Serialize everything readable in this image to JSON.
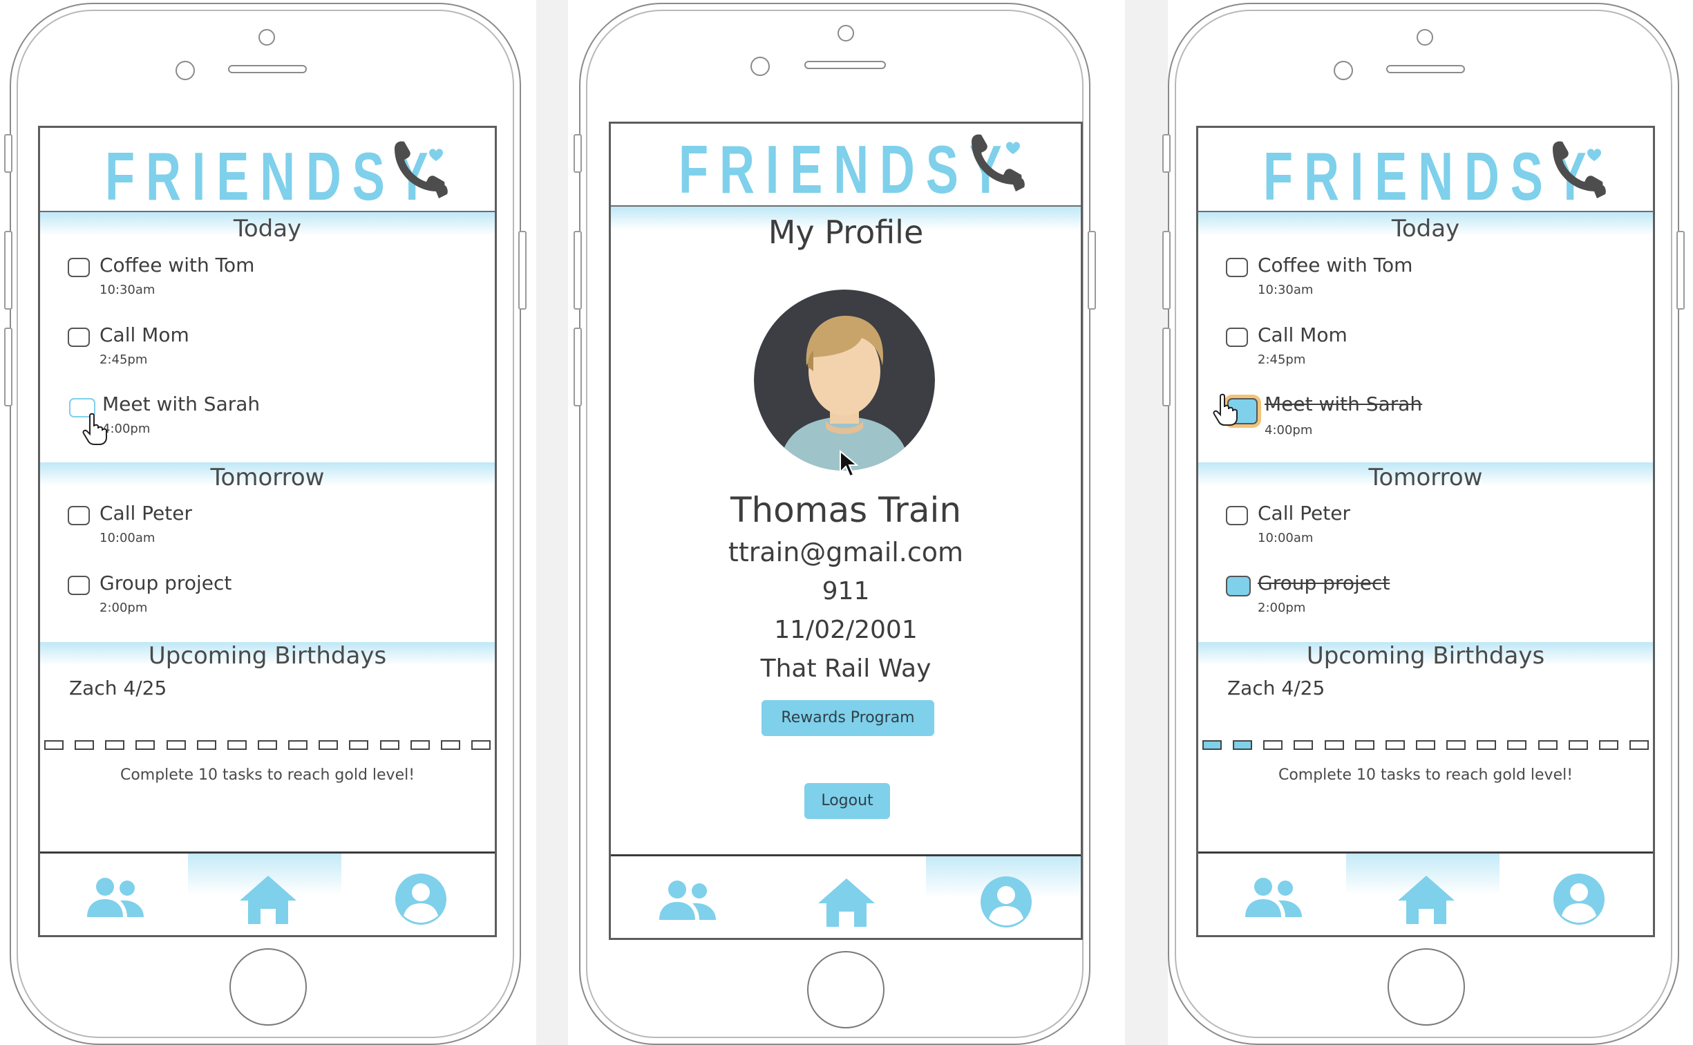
{
  "brand": {
    "name": "FRIENDSY",
    "accent": "#7fd0eb",
    "icon": "phone-heart-icon"
  },
  "screens": [
    {
      "id": "home-before",
      "sections": {
        "today": "Today",
        "tomorrow": "Tomorrow",
        "birthdays": "Upcoming Birthdays"
      },
      "today_tasks": [
        {
          "label": "Coffee with Tom",
          "time": "10:30am",
          "checked": false
        },
        {
          "label": "Call Mom",
          "time": "2:45pm",
          "checked": false
        },
        {
          "label": "Meet with Sarah",
          "time": "4:00pm",
          "checked": false
        }
      ],
      "tomorrow_tasks": [
        {
          "label": "Call Peter",
          "time": "10:00am",
          "checked": false
        },
        {
          "label": "Group project",
          "time": "2:00pm",
          "checked": false
        }
      ],
      "birthdays": [
        {
          "text": "Zach 4/25"
        }
      ],
      "progress": {
        "total": 15,
        "filled": 0
      },
      "gold_message": "Complete 10 tasks to reach gold level!",
      "active_tab": "home"
    },
    {
      "id": "profile",
      "title": "My Profile",
      "name": "Thomas Train",
      "email": "ttrain@gmail.com",
      "phone": "911",
      "dob": "11/02/2001",
      "address": "That Rail Way",
      "rewards_button": "Rewards Program",
      "logout_button": "Logout",
      "active_tab": "profile"
    },
    {
      "id": "home-after",
      "sections": {
        "today": "Today",
        "tomorrow": "Tomorrow",
        "birthdays": "Upcoming Birthdays"
      },
      "today_tasks": [
        {
          "label": "Coffee with Tom",
          "time": "10:30am",
          "checked": false
        },
        {
          "label": "Call Mom",
          "time": "2:45pm",
          "checked": false
        },
        {
          "label": "Meet with Sarah",
          "time": "4:00pm",
          "checked": true
        }
      ],
      "tomorrow_tasks": [
        {
          "label": "Call Peter",
          "time": "10:00am",
          "checked": false
        },
        {
          "label": "Group project",
          "time": "2:00pm",
          "checked": true
        }
      ],
      "birthdays": [
        {
          "text": "Zach 4/25"
        }
      ],
      "progress": {
        "total": 15,
        "filled": 2
      },
      "gold_message": "Complete 10 tasks to reach gold level!",
      "active_tab": "home"
    }
  ],
  "nav": {
    "friends_icon": "friends-icon",
    "home_icon": "home-icon",
    "profile_icon": "profile-icon"
  }
}
